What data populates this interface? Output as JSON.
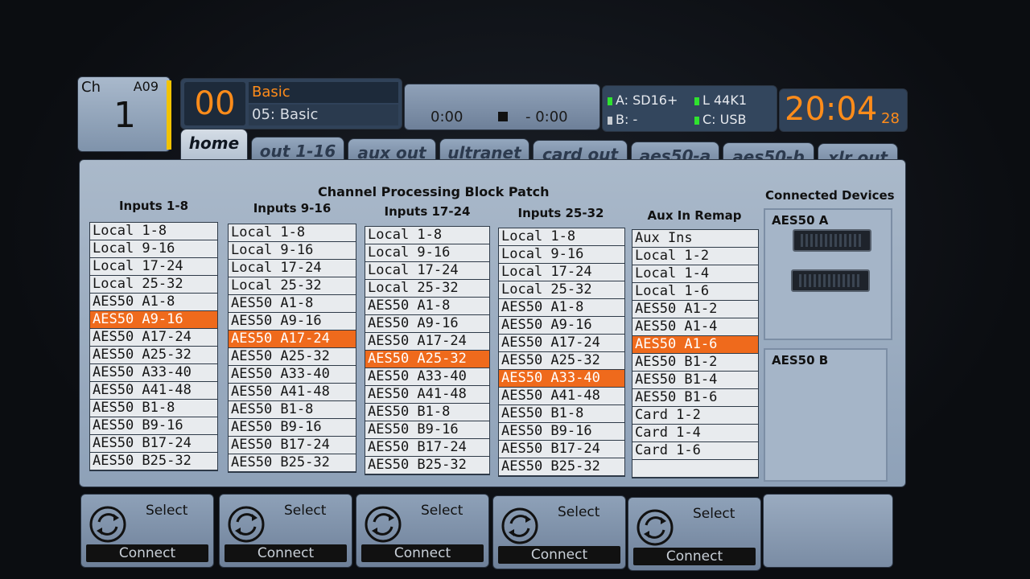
{
  "channel": {
    "label": "Ch",
    "number": "1",
    "source": "A09"
  },
  "scene": {
    "number": "00",
    "title": "Basic",
    "subtitle": "05: Basic"
  },
  "transport": {
    "elapsed": "0:00",
    "remaining": "- 0:00"
  },
  "status": {
    "a": "A: SD16+",
    "b": "B:   -",
    "l": "L   44K1",
    "c": "C: USB",
    "led_green": "#2fe22f",
    "led_gray": "#c8cdd3"
  },
  "clock": {
    "time": "20:04",
    "seconds": "28"
  },
  "tabs": [
    {
      "label": "home"
    },
    {
      "label": "out 1-16"
    },
    {
      "label": "aux out"
    },
    {
      "label": "ultranet"
    },
    {
      "label": "card out"
    },
    {
      "label": "aes50-a"
    },
    {
      "label": "aes50-b"
    },
    {
      "label": "xlr out"
    }
  ],
  "main": {
    "title": "Channel Processing Block Patch",
    "columns": [
      {
        "header": "Inputs 1-8",
        "items": [
          "Local 1-8",
          "Local 9-16",
          "Local 17-24",
          "Local 25-32",
          "AES50 A1-8",
          "AES50 A9-16",
          "AES50 A17-24",
          "AES50 A25-32",
          "AES50 A33-40",
          "AES50 A41-48",
          "AES50 B1-8",
          "AES50 B9-16",
          "AES50 B17-24",
          "AES50 B25-32"
        ],
        "selected": 5
      },
      {
        "header": "Inputs 9-16",
        "items": [
          "Local 1-8",
          "Local 9-16",
          "Local 17-24",
          "Local 25-32",
          "AES50 A1-8",
          "AES50 A9-16",
          "AES50 A17-24",
          "AES50 A25-32",
          "AES50 A33-40",
          "AES50 A41-48",
          "AES50 B1-8",
          "AES50 B9-16",
          "AES50 B17-24",
          "AES50 B25-32"
        ],
        "selected": 6
      },
      {
        "header": "Inputs 17-24",
        "items": [
          "Local 1-8",
          "Local 9-16",
          "Local 17-24",
          "Local 25-32",
          "AES50 A1-8",
          "AES50 A9-16",
          "AES50 A17-24",
          "AES50 A25-32",
          "AES50 A33-40",
          "AES50 A41-48",
          "AES50 B1-8",
          "AES50 B9-16",
          "AES50 B17-24",
          "AES50 B25-32"
        ],
        "selected": 7
      },
      {
        "header": "Inputs 25-32",
        "items": [
          "Local 1-8",
          "Local 9-16",
          "Local 17-24",
          "Local 25-32",
          "AES50 A1-8",
          "AES50 A9-16",
          "AES50 A17-24",
          "AES50 A25-32",
          "AES50 A33-40",
          "AES50 A41-48",
          "AES50 B1-8",
          "AES50 B9-16",
          "AES50 B17-24",
          "AES50 B25-32"
        ],
        "selected": 8
      },
      {
        "header": "Aux In Remap",
        "items": [
          "Aux Ins",
          "Local 1-2",
          "Local 1-4",
          "Local 1-6",
          "AES50 A1-2",
          "AES50 A1-4",
          "AES50 A1-6",
          "AES50 B1-2",
          "AES50 B1-4",
          "AES50 B1-6",
          "Card 1-2",
          "Card 1-4",
          "Card 1-6",
          ""
        ],
        "selected": 6
      }
    ],
    "selected_color": "#ef6a1c"
  },
  "devices": {
    "title": "Connected Devices",
    "aes50a": "AES50 A",
    "aes50b": "AES50 B"
  },
  "encoders": [
    {
      "select": "Select",
      "connect": "Connect"
    },
    {
      "select": "Select",
      "connect": "Connect"
    },
    {
      "select": "Select",
      "connect": "Connect"
    },
    {
      "select": "Select",
      "connect": "Connect"
    },
    {
      "select": "Select",
      "connect": "Connect"
    }
  ]
}
